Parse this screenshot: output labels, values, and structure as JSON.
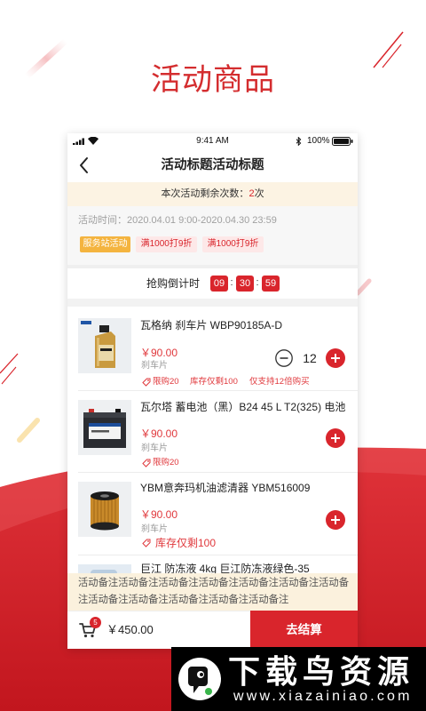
{
  "page_heading": "活动商品",
  "status_bar": {
    "time": "9:41 AM",
    "battery": "100%",
    "icons": [
      "signal-icon",
      "wifi-icon",
      "bluetooth-icon",
      "battery-icon"
    ]
  },
  "nav": {
    "title": "活动标题活动标题",
    "back_icon": "chevron-left-icon"
  },
  "remaining": {
    "label": "本次活动剩余次数：",
    "count": "2",
    "unit": "次"
  },
  "activity": {
    "time": "活动时间：2020.04.01 9:00-2020.04.30 23:59",
    "tags": [
      "服务站活动",
      "满1000打9折",
      "满1000打9折"
    ]
  },
  "countdown": {
    "label": "抢购倒计时",
    "hours": "09",
    "minutes": "30",
    "seconds": "59",
    "separator": ":"
  },
  "products": [
    {
      "name": "瓦格纳 刹车片 WBP90185A-D",
      "price": "￥90.00",
      "category": "刹车片",
      "limit": "限购20",
      "stock": "库存仅剩100",
      "multiple": "仅支持12倍购买",
      "quantity": "12"
    },
    {
      "name": "瓦尔塔 蓄电池（黑）B24 45 L T2(325) 电池",
      "price": "￥90.00",
      "category": "刹车片",
      "limit": "限购20"
    },
    {
      "name": "YBM意奔玛机油滤清器 YBM516009",
      "price": "￥90.00",
      "category": "刹车片",
      "stock": "库存仅剩100"
    },
    {
      "name": "巨江 防冻液 4kg 巨江防冻液绿色-35"
    }
  ],
  "note": {
    "line1": "活动备注活动备注活动备注活动备注活动备注活动备注活动备",
    "line2": "注活动备注活动备注活动备注活动备注活动备注"
  },
  "bottom_bar": {
    "cart_icon": "cart-icon",
    "cart_count": "5",
    "total": "￥450.00",
    "checkout": "去结算"
  },
  "watermark": {
    "brand": "下载鸟资源",
    "url": "www.xiazainiao.com"
  },
  "colors": {
    "brand_red": "#d9252c",
    "heading_red": "#d42d2f",
    "banner_bg": "#fcf3e3",
    "service_tag_bg": "#f4b43f",
    "discount_tag_bg": "#fde8e8",
    "price_red": "#e0383c"
  }
}
